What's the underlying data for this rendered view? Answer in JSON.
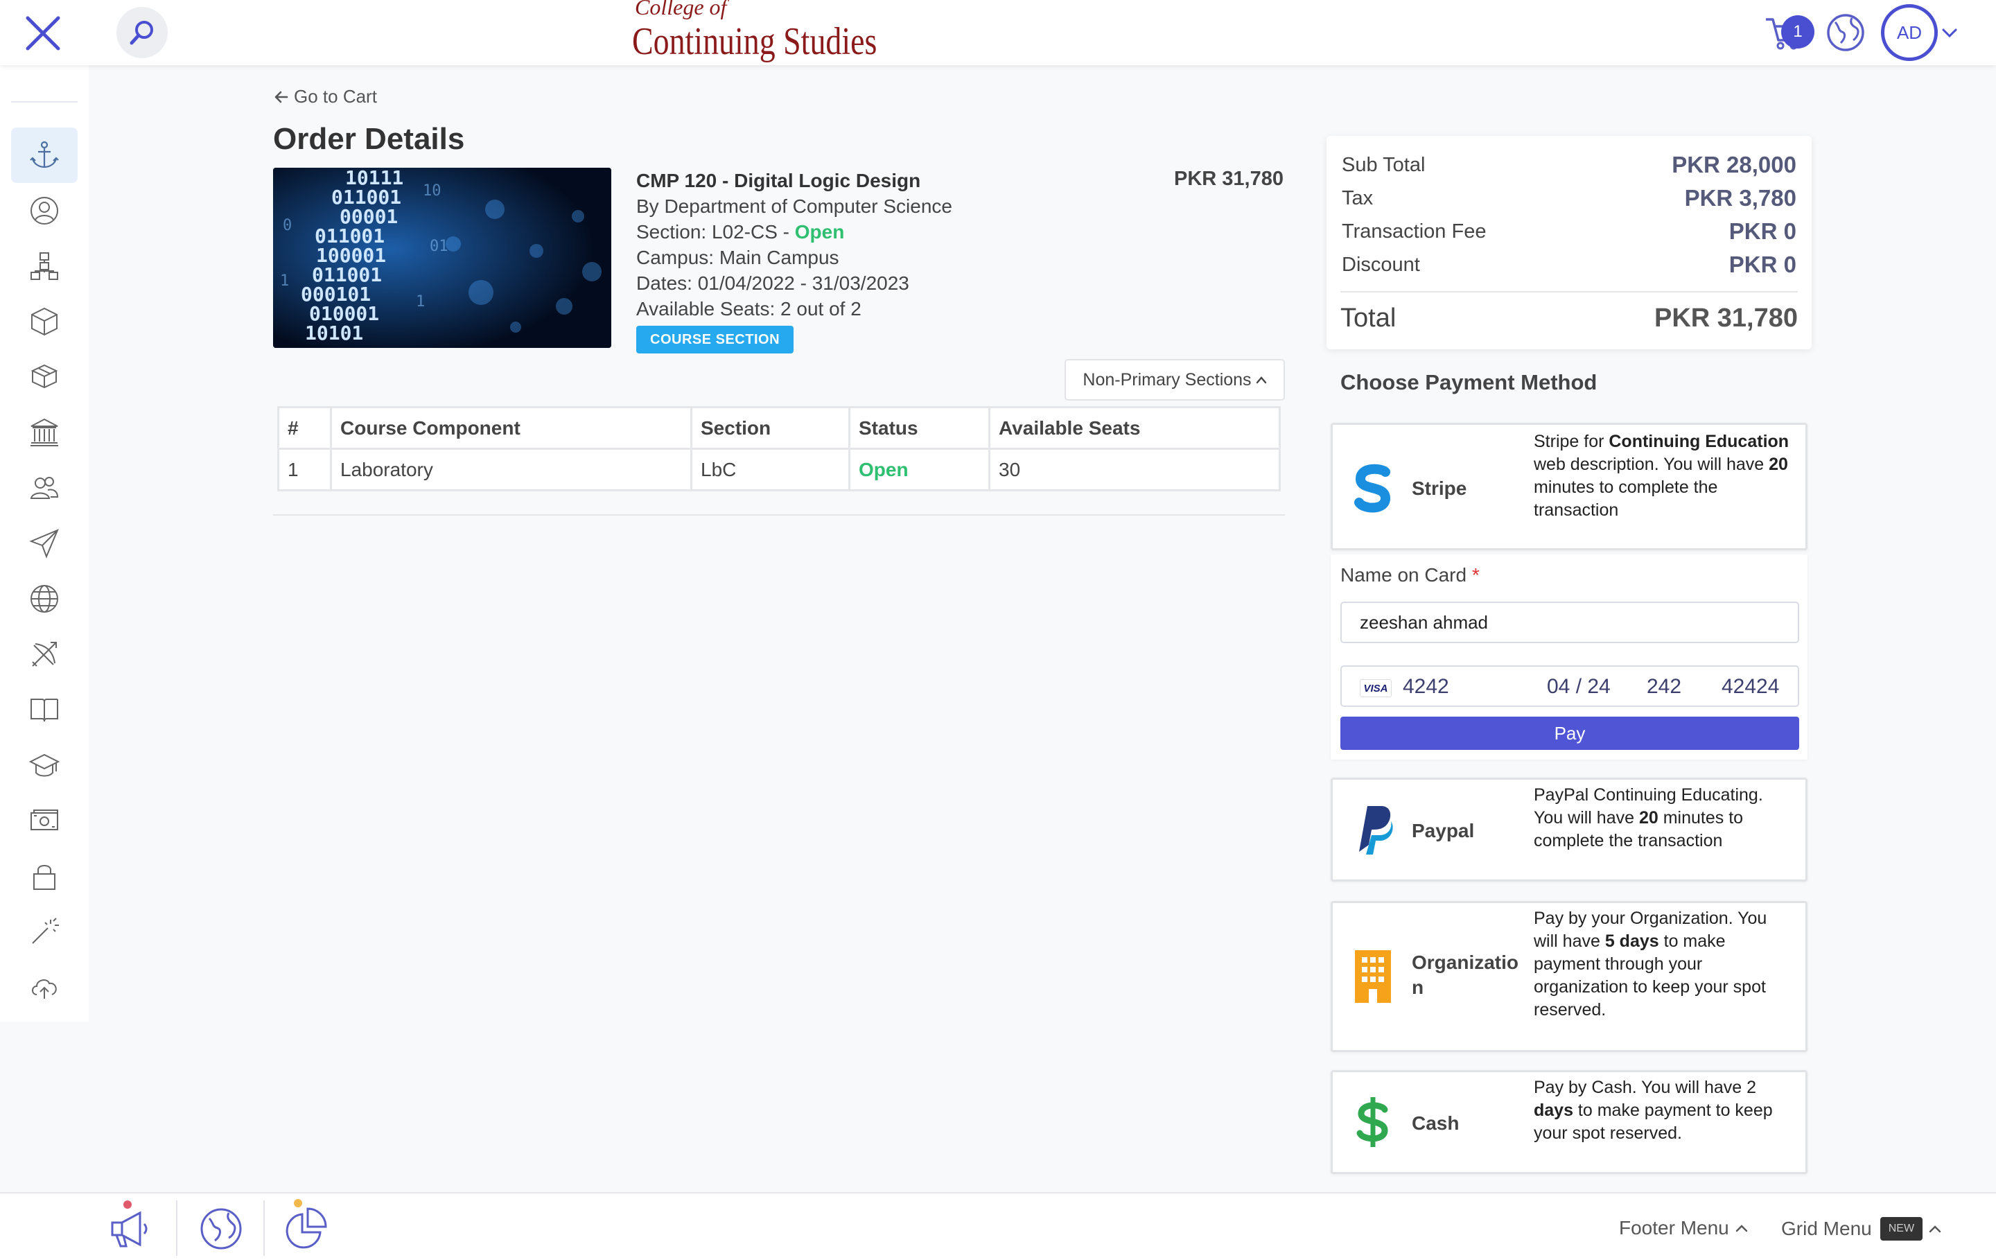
{
  "header": {
    "logo_line1": "College of",
    "logo_line2": "Continuing Studies",
    "cart_count": "1",
    "avatar_initials": "AD"
  },
  "sidebar": {
    "items": [
      "anchor-icon",
      "user-circle-icon",
      "hierarchy-icon",
      "cube-icon",
      "boxes-icon",
      "institution-icon",
      "users-icon",
      "paper-plane-icon",
      "globe-icon",
      "archery-icon",
      "book-icon",
      "graduation-cap-icon",
      "money-icon",
      "lock-icon",
      "magic-wand-icon",
      "cloud-upload-icon"
    ]
  },
  "main": {
    "back_label": "Go to Cart",
    "title": "Order Details",
    "course": {
      "title": "CMP 120 - Digital Logic Design",
      "department": "By Department of Computer Science",
      "section_prefix": "Section: L02-CS - ",
      "section_status": "Open",
      "campus": "Campus: Main Campus",
      "dates": "Dates: 01/04/2022 - 31/03/2023",
      "seats": "Available Seats: 2 out of 2",
      "price": "PKR 31,780",
      "badge": "COURSE SECTION"
    },
    "non_primary_label": "Non-Primary Sections",
    "table": {
      "headers": [
        "#",
        "Course Component",
        "Section",
        "Status",
        "Available Seats"
      ],
      "rows": [
        [
          "1",
          "Laboratory",
          "LbC",
          "Open",
          "30"
        ]
      ]
    }
  },
  "summary": {
    "rows": [
      {
        "label": "Sub Total",
        "value": "PKR 28,000"
      },
      {
        "label": "Tax",
        "value": "PKR 3,780"
      },
      {
        "label": "Transaction Fee",
        "value": "PKR 0"
      },
      {
        "label": "Discount",
        "value": "PKR 0"
      }
    ],
    "total_label": "Total",
    "total_value": "PKR 31,780"
  },
  "payment": {
    "heading": "Choose Payment Method",
    "stripe": {
      "name": "Stripe",
      "desc_1": "Stripe for ",
      "desc_bold_1": "Continuing Education",
      "desc_2": " web description. You will have ",
      "desc_bold_2": "20",
      "desc_3": " minutes to complete the transaction"
    },
    "card": {
      "name_label": "Name on Card",
      "required_mark": "*",
      "name_value": "zeeshan ahmad",
      "brand": "VISA",
      "number": "4242",
      "expiry": "04 / 24",
      "cvc": "242",
      "zip": "42424",
      "pay_label": "Pay"
    },
    "paypal": {
      "name": "Paypal",
      "desc_1": "PayPal Continuing Educating. You will have ",
      "desc_bold_1": "20",
      "desc_2": " minutes to complete the transaction"
    },
    "organization": {
      "name": "Organization",
      "desc_1": "Pay by your Organization. You will have ",
      "desc_bold_1": "5 days",
      "desc_2": " to make payment through your organization to keep your spot reserved."
    },
    "cash": {
      "name": "Cash",
      "desc_1": "Pay by Cash. You will have 2 ",
      "desc_bold_1": "days",
      "desc_2": " to make payment to keep your spot reserved."
    }
  },
  "footer": {
    "footer_menu": "Footer Menu",
    "grid_menu": "Grid Menu",
    "new_badge": "NEW"
  },
  "colors": {
    "accent": "#4a4fd1",
    "open_green": "#2fbf71",
    "badge_blue": "#27a9f0",
    "logo_red": "#8b1a1a",
    "stripe_blue": "#1a8fe0",
    "org_orange": "#f7a21b",
    "cash_green": "#2fa84f"
  }
}
